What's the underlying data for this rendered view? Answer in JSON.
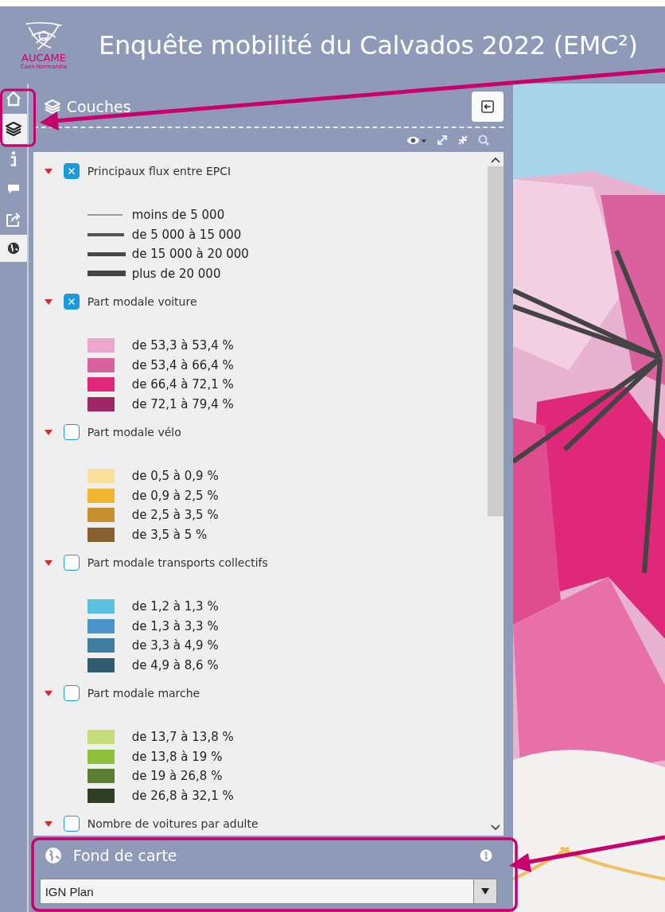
{
  "header": {
    "logo": {
      "name": "AUCAME",
      "subtitle": "Caen Normandie"
    },
    "title": "Enquête mobilité du Calvados 2022 (EMC²)"
  },
  "tools": [
    {
      "selected": false,
      "highlighted": false
    },
    {
      "selected": true,
      "highlighted": true
    },
    {
      "selected": false,
      "highlighted": false
    },
    {
      "selected": false,
      "highlighted": false
    },
    {
      "selected": false,
      "highlighted": false
    }
  ],
  "extra_tool": {
    "selected": true
  },
  "layers_panel": {
    "title": "Couches",
    "layers": [
      {
        "title": "Principaux flux entre EPCI",
        "checked": true,
        "expanded": true,
        "kind": "lines",
        "legend": [
          {
            "label": "moins de 5 000",
            "color": "#9a9a9a"
          },
          {
            "label": "de 5 000 à 15 000",
            "color": "#555555"
          },
          {
            "label": "de 15 000 à 20 000",
            "color": "#484848"
          },
          {
            "label": "plus de 20 000",
            "color": "#444444"
          }
        ]
      },
      {
        "title": "Part modale voiture",
        "checked": true,
        "expanded": true,
        "kind": "swatches",
        "legend": [
          {
            "label": "de 53,3 à 53,4 %",
            "color": "#eba6cc"
          },
          {
            "label": "de 53,4 à 66,4 %",
            "color": "#d9619e"
          },
          {
            "label": "de 66,4 à 72,1 %",
            "color": "#e0287a"
          },
          {
            "label": "de 72,1 à 79,4 %",
            "color": "#a02763"
          }
        ]
      },
      {
        "title": "Part modale vélo",
        "checked": false,
        "expanded": true,
        "kind": "swatches",
        "legend": [
          {
            "label": "de 0,5 à 0,9 %",
            "color": "#fbdf9a"
          },
          {
            "label": "de 0,9 à 2,5 %",
            "color": "#f2b632"
          },
          {
            "label": "de 2,5 à 3,5 %",
            "color": "#c68f2f"
          },
          {
            "label": "de 3,5 à 5 %",
            "color": "#86602c"
          }
        ]
      },
      {
        "title": "Part modale transports collectifs",
        "checked": false,
        "expanded": true,
        "kind": "swatches",
        "legend": [
          {
            "label": "de 1,2 à 1,3 %",
            "color": "#5bbfe0"
          },
          {
            "label": "de 1,3 à 3,3 %",
            "color": "#4a94cc"
          },
          {
            "label": "de 3,3 à 4,9 %",
            "color": "#3f7ea1"
          },
          {
            "label": "de 4,9 à 8,6 %",
            "color": "#335b72"
          }
        ]
      },
      {
        "title": "Part modale marche",
        "checked": false,
        "expanded": true,
        "kind": "swatches",
        "legend": [
          {
            "label": "de 13,7 à 13,8 %",
            "color": "#c7dc7a"
          },
          {
            "label": "de 13,8 à 19 %",
            "color": "#8dbf3a"
          },
          {
            "label": "de 19 à 26,8 %",
            "color": "#5a7f32"
          },
          {
            "label": "de 26,8 à 32,1 %",
            "color": "#2e3d24"
          }
        ]
      },
      {
        "title": "Nombre de voitures par adulte",
        "checked": false,
        "expanded": true
      }
    ]
  },
  "basemap_panel": {
    "title": "Fond de carte",
    "highlighted": true,
    "select": {
      "value": "IGN Plan"
    }
  }
}
